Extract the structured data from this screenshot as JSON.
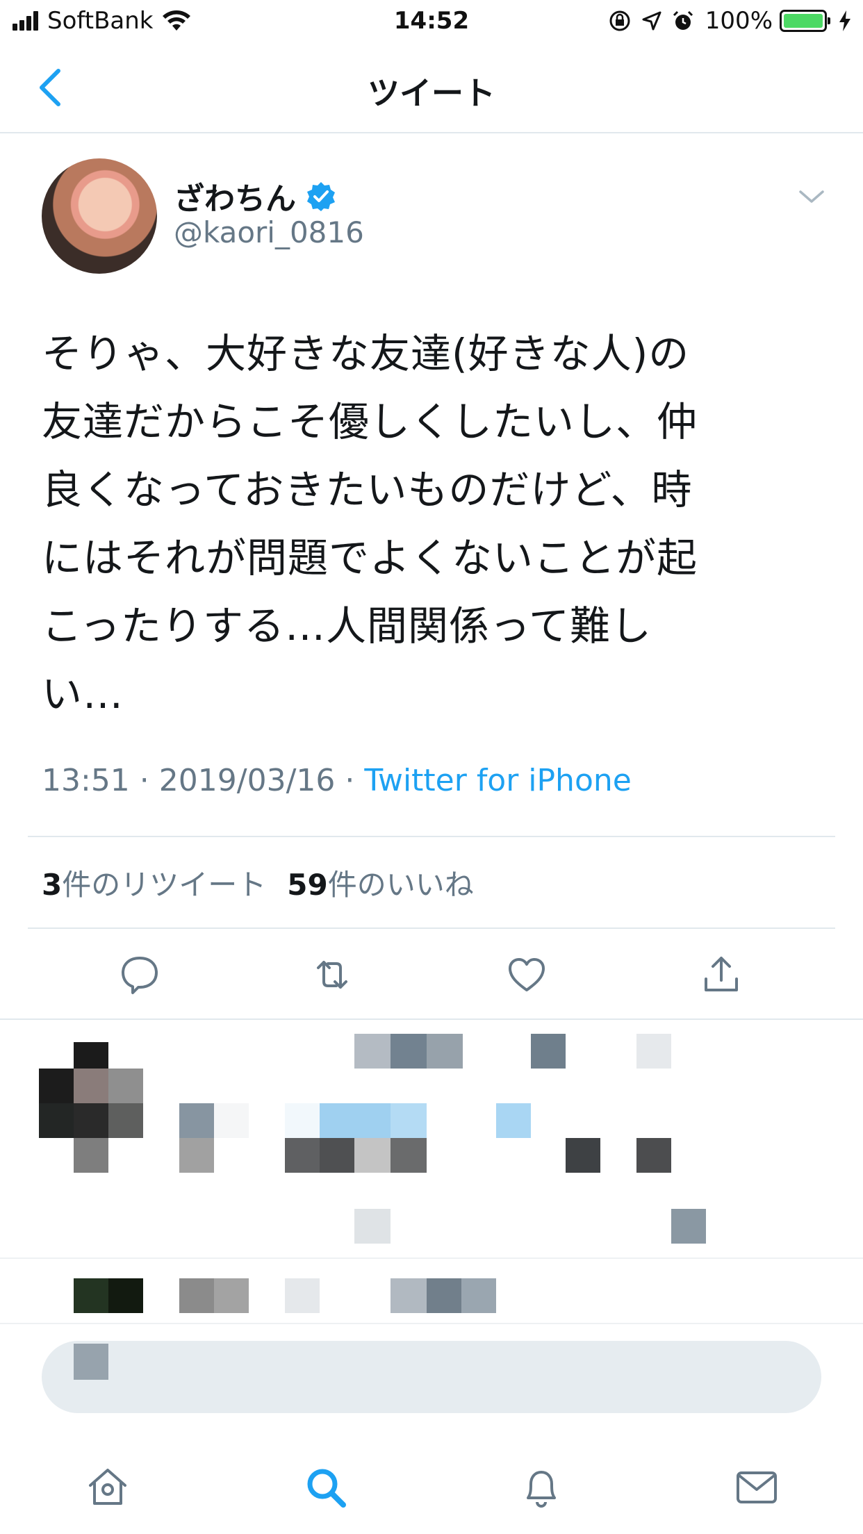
{
  "status_bar": {
    "carrier": "SoftBank",
    "time": "14:52",
    "battery": "100%"
  },
  "nav": {
    "title": "ツイート",
    "back_icon": "chevron-left-icon"
  },
  "tweet": {
    "display_name": "ざわちん",
    "handle": "@kaori_0816",
    "verified": true,
    "text_lines": [
      "そりゃ、大好きな友達(好きな人)の",
      "友達だからこそ優しくしたいし、仲",
      "良くなっておきたいものだけど、時",
      "にはそれが問題でよくないことが起",
      "こったりする…人間関係って難し",
      "い…"
    ],
    "time": "13:51",
    "separator": " · ",
    "date": "2019/03/16",
    "source": "Twitter for iPhone",
    "retweet_count": "3",
    "retweet_label": "件のリツイート",
    "like_count": "59",
    "like_label": "件のいいね"
  },
  "actions": [
    "reply-icon",
    "retweet-icon",
    "like-icon",
    "share-icon"
  ],
  "tabbar": [
    "home-icon",
    "search-icon",
    "notifications-icon",
    "messages-icon"
  ],
  "colors": {
    "accent": "#1da1f2",
    "secondary_text": "#657786",
    "divider": "#e1e8ed",
    "battery": "#4cd964"
  }
}
